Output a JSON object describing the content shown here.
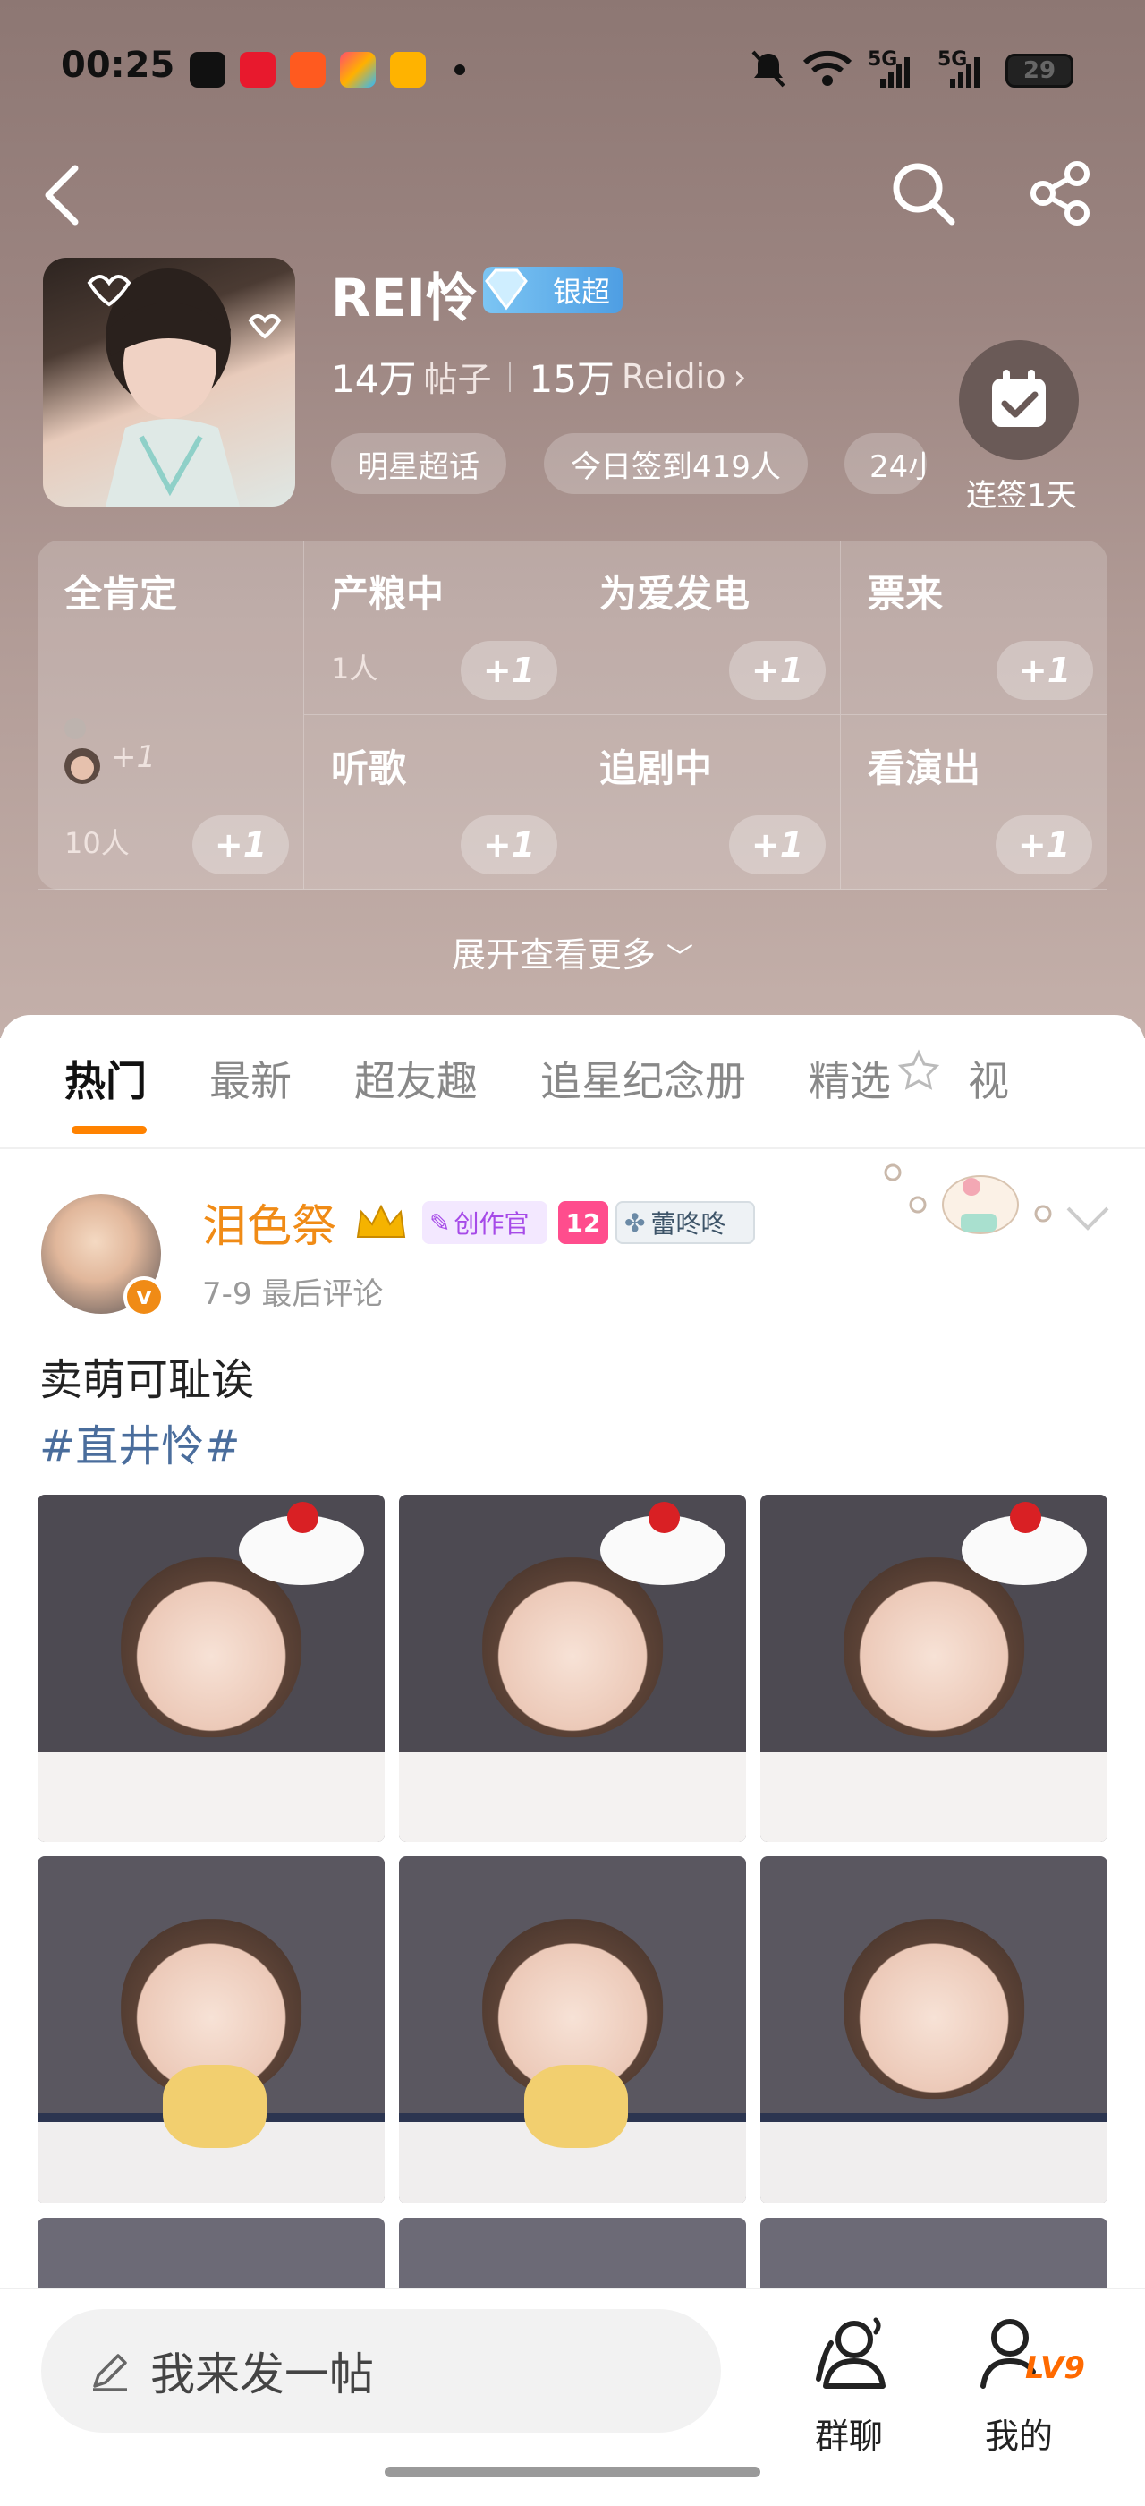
{
  "status_bar": {
    "time": "00:25",
    "signal_1": "5G",
    "signal_2": "5G",
    "battery": "29",
    "app_icons": [
      "tiktok-icon",
      "redbook-icon",
      "app3-icon",
      "app4-icon",
      "video-icon"
    ]
  },
  "header": {
    "back_icon": "chevron-left-icon",
    "search_icon": "search-icon",
    "share_icon": "share-icon"
  },
  "profile": {
    "title": "REI怜",
    "badge_label": "银超",
    "badge_level": "1",
    "posts_count": "14万",
    "posts_label": "帖子",
    "followers_count": "15万",
    "followers_label": "Reidio",
    "pills": [
      "明星超话",
      "今日签到419人",
      "24小"
    ],
    "checkin_label": "连签1天"
  },
  "reaction_grid": {
    "plus_label": "+1",
    "first": {
      "name": "全肯定",
      "mini_plus": "+1",
      "count": "10人"
    },
    "cells": [
      {
        "name": "产粮中",
        "count": "1人"
      },
      {
        "name": "为爱发电",
        "count": ""
      },
      {
        "name": "票来",
        "count": ""
      },
      {
        "name": "听歌",
        "count": ""
      },
      {
        "name": "追剧中",
        "count": ""
      },
      {
        "name": "看演出",
        "count": ""
      }
    ],
    "expand_label": "展开查看更多"
  },
  "tabs": [
    "热门",
    "最新",
    "超友趣",
    "追星纪念册",
    "精选",
    "视"
  ],
  "post": {
    "username": "泪色祭",
    "badge_creator": "创作官",
    "badge_level": "12",
    "badge_fan": "蕾咚咚",
    "time": "7-9 最后评论",
    "text": "卖萌可耻诶",
    "hashtag": "#直井怜#",
    "verified": "v"
  },
  "bottom_bar": {
    "input_placeholder": "我来发一帖",
    "group_label": "群聊",
    "me_label": "我的",
    "me_level": "LV9"
  },
  "colors": {
    "accent": "#ff8200",
    "username": "#f08b16",
    "hashtag": "#4a6d9c"
  }
}
